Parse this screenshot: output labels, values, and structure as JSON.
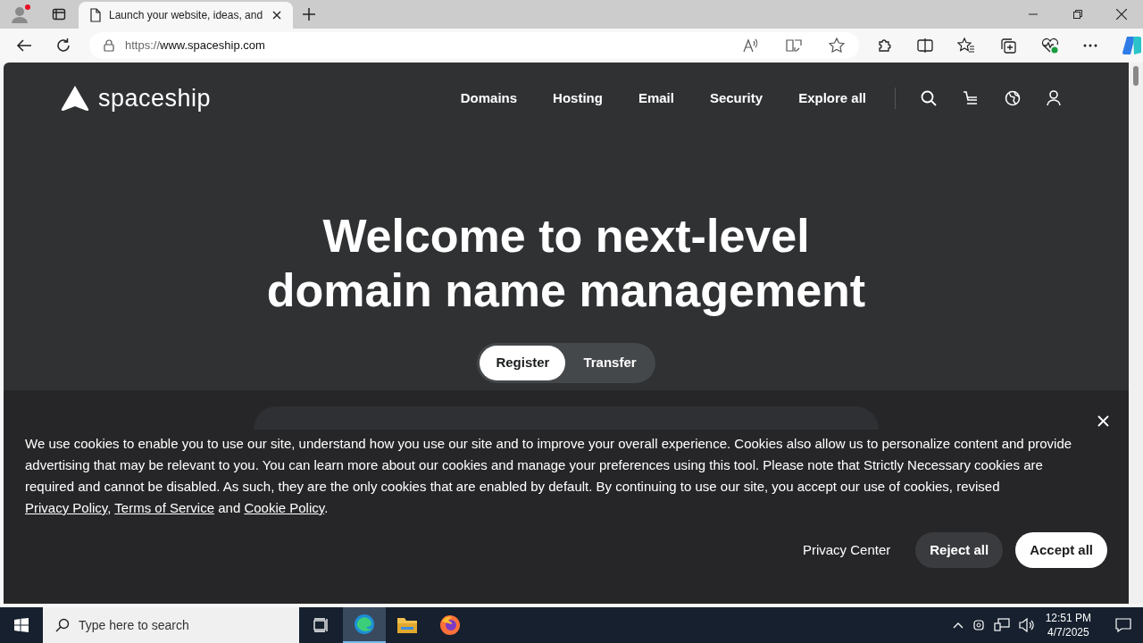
{
  "browser": {
    "tab_title": "Launch your website, ideas, and",
    "url_scheme": "https://",
    "url_host": "www.spaceship.com"
  },
  "header": {
    "logo": "spaceship",
    "nav": [
      "Domains",
      "Hosting",
      "Email",
      "Security",
      "Explore all"
    ]
  },
  "hero": {
    "title_lines": [
      "Welcome to next-level",
      "domain name management"
    ],
    "toggle": [
      {
        "label": "Register",
        "selected": true
      },
      {
        "label": "Transfer",
        "selected": false
      }
    ]
  },
  "cookie_banner": {
    "segments": [
      {
        "kind": "text",
        "text": "We use cookies to enable you to use our site, understand how you use our site and to improve your overall experience. Cookies also allow us to personalize content and provide advertising that may be relevant to you. You can learn more about our cookies and manage your preferences using this tool. Please note that Strictly Necessary cookies are required and cannot be disabled. As such, they are the only cookies that are enabled by default. By continuing to use our site, you accept our use of cookies, revised "
      },
      {
        "kind": "link",
        "text": "Privacy Policy"
      },
      {
        "kind": "text",
        "text": ", "
      },
      {
        "kind": "link",
        "text": "Terms of Service"
      },
      {
        "kind": "text",
        "text": " and "
      },
      {
        "kind": "link",
        "text": "Cookie Policy"
      },
      {
        "kind": "text",
        "text": "."
      }
    ],
    "buttons": [
      {
        "label": "Privacy Center",
        "kind": "plain"
      },
      {
        "label": "Reject all",
        "kind": "secondary"
      },
      {
        "label": "Accept all",
        "kind": "primary"
      }
    ]
  },
  "taskbar": {
    "search_placeholder": "Type here to search",
    "time": "12:51 PM",
    "date": "4/7/2025"
  }
}
